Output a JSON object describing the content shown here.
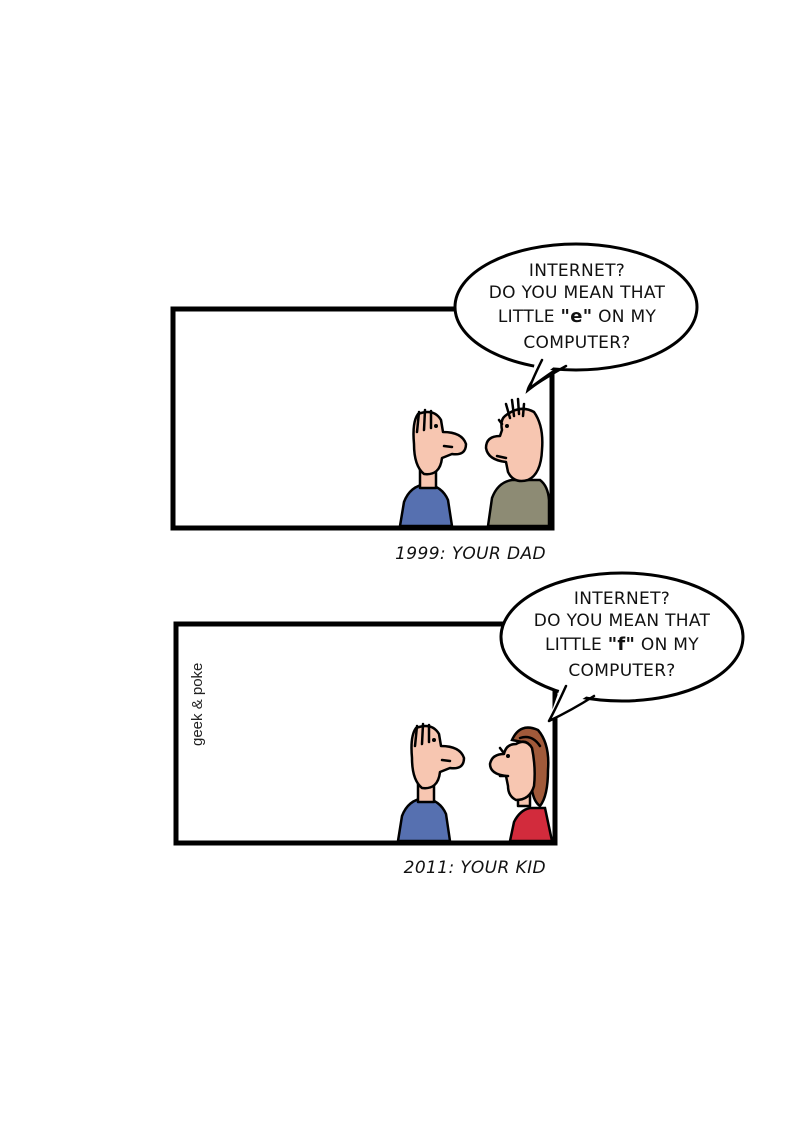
{
  "panels": [
    {
      "bubble_lines": [
        "INTERNET?",
        "DO YOU MEAN THAT"
      ],
      "bubble_line3_prefix": "LITTLE ",
      "bubble_line3_letter": "\"e\"",
      "bubble_line3_suffix": " ON MY",
      "bubble_line4": "COMPUTER?",
      "caption": "1999: YOUR DAD"
    },
    {
      "bubble_lines": [
        "INTERNET?",
        "DO YOU MEAN THAT"
      ],
      "bubble_line3_prefix": "LITTLE ",
      "bubble_line3_letter": "\"f\"",
      "bubble_line3_suffix": " ON MY",
      "bubble_line4": "COMPUTER?",
      "caption": "2011: YOUR KID"
    }
  ],
  "credit": "geek & poke",
  "colors": {
    "skin": "#f7c6b1",
    "shirt_blue": "#5670b0",
    "shirt_olive": "#8d8b74",
    "shirt_red": "#d22b3c",
    "hair_brown": "#a05a3a"
  }
}
